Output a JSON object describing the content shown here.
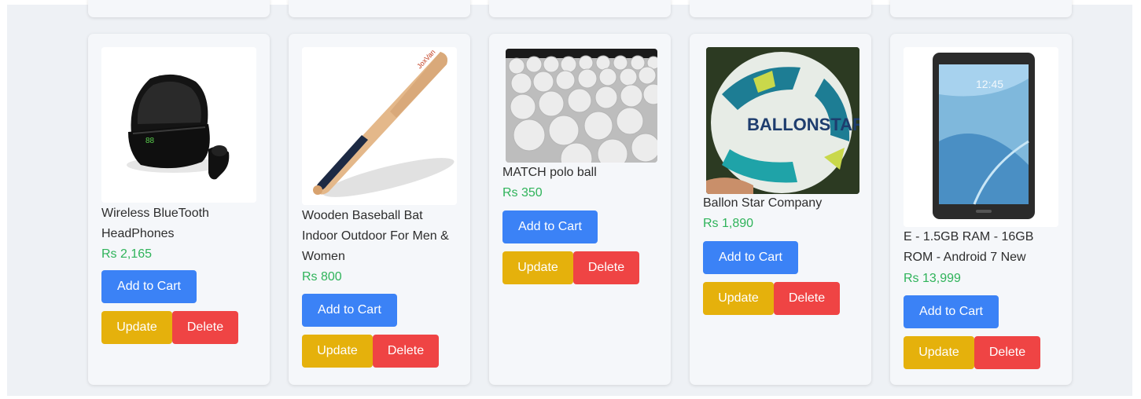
{
  "products": [
    {
      "title": "Wireless BlueTooth HeadPhones",
      "price": "Rs 2,165",
      "image_icon": "earbuds-icon",
      "add_label": "Add to Cart",
      "update_label": "Update",
      "delete_label": "Delete"
    },
    {
      "title": "Wooden Baseball Bat Indoor Outdoor For Men & Women",
      "price": "Rs 800",
      "image_icon": "baseball-bat-icon",
      "add_label": "Add to Cart",
      "update_label": "Update",
      "delete_label": "Delete"
    },
    {
      "title": "MATCH polo ball",
      "price": "Rs 350",
      "image_icon": "polo-balls-icon",
      "add_label": "Add to Cart",
      "update_label": "Update",
      "delete_label": "Delete"
    },
    {
      "title": "Ballon Star Company",
      "price": "Rs 1,890",
      "image_icon": "football-icon",
      "image_text": "BALLONSTAR",
      "add_label": "Add to Cart",
      "update_label": "Update",
      "delete_label": "Delete"
    },
    {
      "title": "E - 1.5GB RAM - 16GB ROM - Android 7 New",
      "price": "Rs 13,999",
      "image_icon": "tablet-icon",
      "image_text": "12:45",
      "add_label": "Add to Cart",
      "update_label": "Update",
      "delete_label": "Delete"
    }
  ],
  "colors": {
    "add_to_cart": "#3b82f6",
    "update": "#e5b10c",
    "delete": "#ef4444",
    "price": "#2fb35a"
  }
}
